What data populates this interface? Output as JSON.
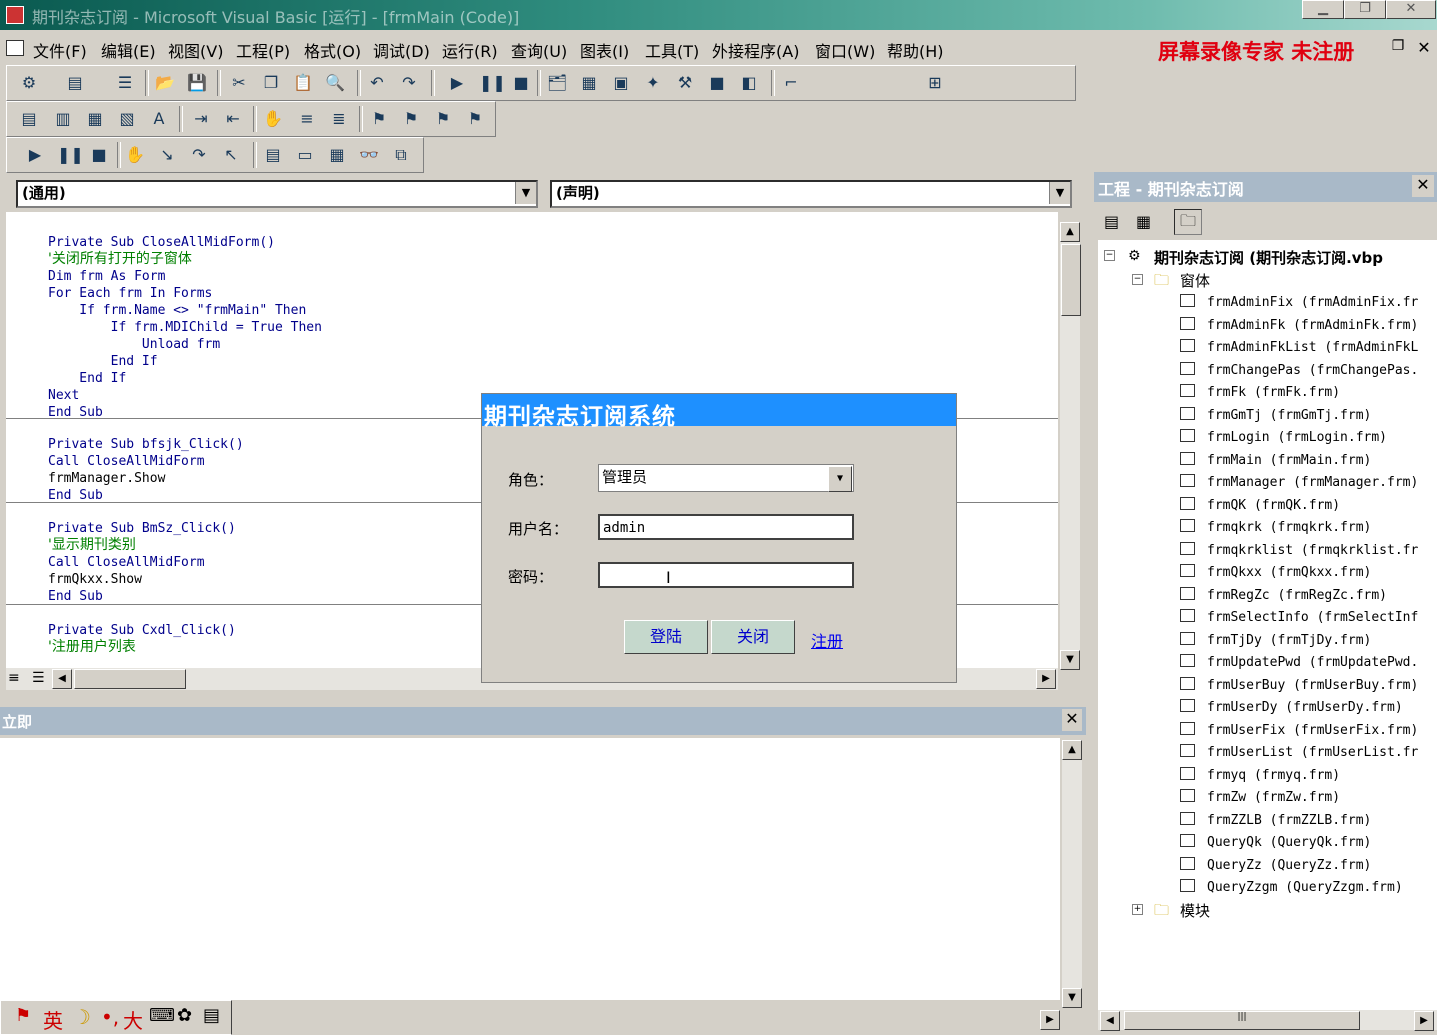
{
  "window": {
    "title": "期刊杂志订阅 - Microsoft Visual Basic [运行] - [frmMain (Code)]"
  },
  "menu": [
    "文件(F)",
    "编辑(E)",
    "视图(V)",
    "工程(P)",
    "格式(O)",
    "调试(D)",
    "运行(R)",
    "查询(U)",
    "图表(I)",
    "工具(T)",
    "外接程序(A)",
    "窗口(W)",
    "帮助(H)"
  ],
  "recorder_notice": "屏幕录像专家  未注册",
  "code_window": {
    "object_combo": "(通用)",
    "proc_combo": "(声明)",
    "blocks": [
      [
        "Private Sub CloseAllMidForm()",
        "'关闭所有打开的子窗体",
        "Dim frm As Form",
        "For Each frm In Forms",
        "    If frm.Name <> \"frmMain\" Then",
        "        If frm.MDIChild = True Then",
        "            Unload frm",
        "        End If",
        "    End If",
        "Next",
        "End Sub"
      ],
      [
        "Private Sub bfsjk_Click()",
        "Call CloseAllMidForm",
        "frmManager.Show",
        "End Sub"
      ],
      [
        "Private Sub BmSz_Click()",
        "'显示期刊类别",
        "Call CloseAllMidForm",
        "frmQkxx.Show",
        "End Sub"
      ],
      [
        "Private Sub Cxdl_Click()",
        "'注册用户列表"
      ]
    ]
  },
  "immediate": {
    "title": "立即"
  },
  "project": {
    "title": "工程 - 期刊杂志订阅",
    "root": "期刊杂志订阅 (期刊杂志订阅.vbp",
    "forms_folder": "窗体",
    "forms": [
      "frmAdminFix (frmAdminFix.fr",
      "frmAdminFk (frmAdminFk.frm)",
      "frmAdminFkList (frmAdminFkL",
      "frmChangePas (frmChangePas.",
      "frmFk (frmFk.frm)",
      "frmGmTj (frmGmTj.frm)",
      "frmLogin (frmLogin.frm)",
      "frmMain (frmMain.frm)",
      "frmManager (frmManager.frm)",
      "frmQK (frmQK.frm)",
      "frmqkrk (frmqkrk.frm)",
      "frmqkrklist (frmqkrklist.fr",
      "frmQkxx (frmQkxx.frm)",
      "frmRegZc (frmRegZc.frm)",
      "frmSelectInfo (frmSelectInf",
      "frmTjDy (frmTjDy.frm)",
      "frmUpdatePwd (frmUpdatePwd.",
      "frmUserBuy (frmUserBuy.frm)",
      "frmUserDy (frmUserDy.frm)",
      "frmUserFix (frmUserFix.frm)",
      "frmUserList (frmUserList.fr",
      "frmyq (frmyq.frm)",
      "frmZw (frmZw.frm)",
      "frmZZLB (frmZZLB.frm)",
      "QueryQk (QueryQk.frm)",
      "QueryZz (QueryZz.frm)",
      "QueryZzgm (QueryZzgm.frm)"
    ],
    "modules_folder": "模块"
  },
  "dialog": {
    "title": "期刊杂志订阅系统",
    "role_label": "角色：",
    "role_value": "管理员",
    "user_label": "用户名：",
    "user_value": "admin",
    "pwd_label": "密码：",
    "pwd_value": "",
    "login_button": "登陆",
    "close_button": "关闭",
    "register_link": "注册"
  },
  "ime": [
    "英",
    "大"
  ]
}
